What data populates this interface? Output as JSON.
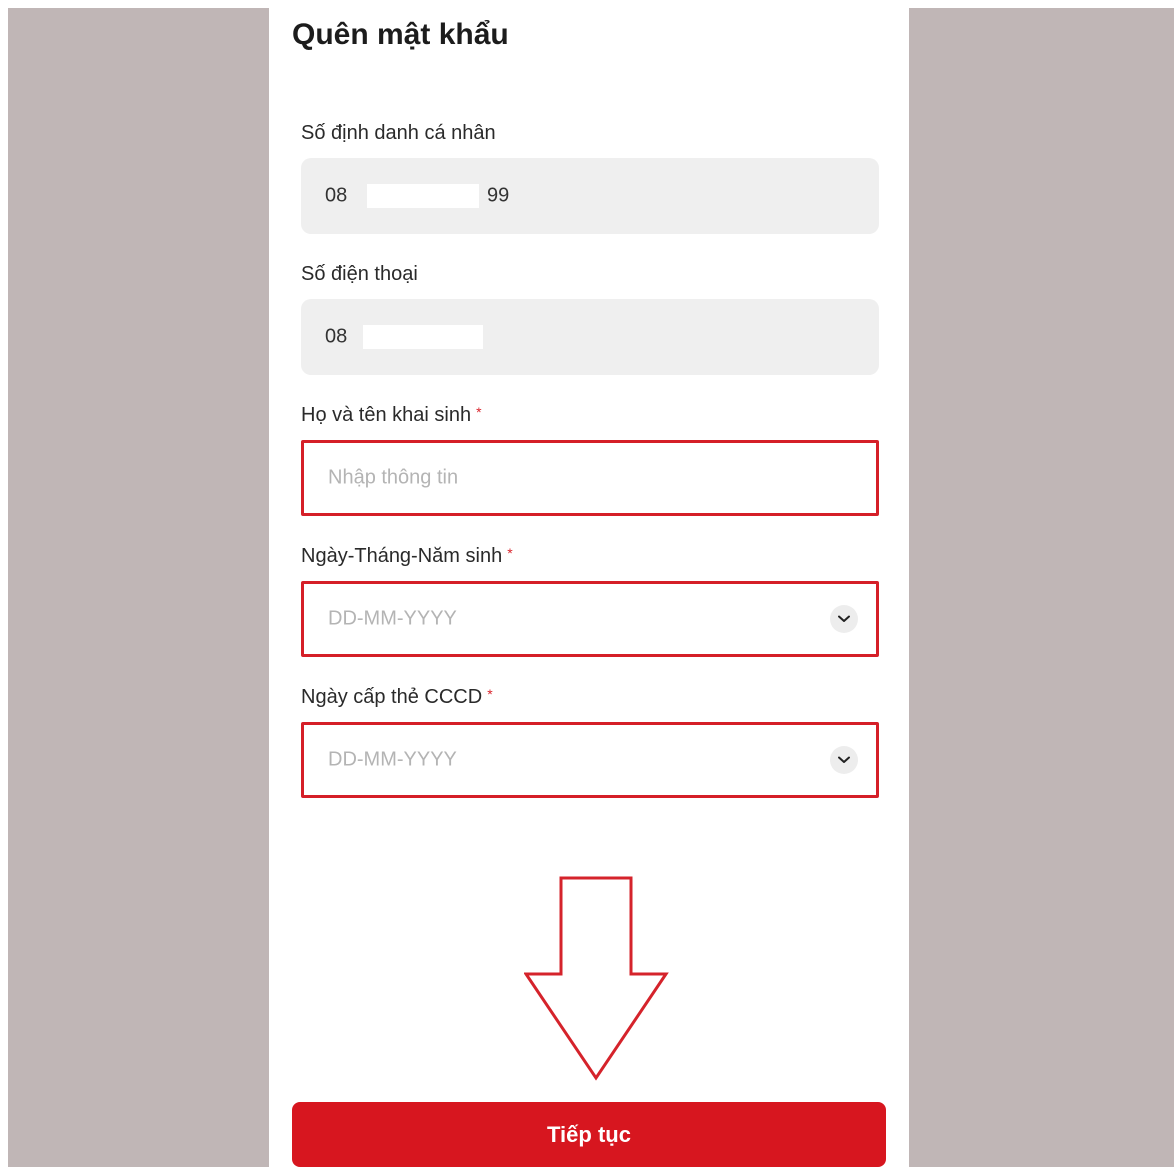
{
  "page": {
    "title": "Quên mật khẩu"
  },
  "form": {
    "id_number": {
      "label": "Số định danh cá nhân",
      "value_prefix": "08",
      "value_suffix": "99"
    },
    "phone": {
      "label": "Số điện thoại",
      "value_prefix": "08"
    },
    "full_name": {
      "label": "Họ và tên khai sinh",
      "required_mark": "*",
      "placeholder": "Nhập thông tin"
    },
    "birth_date": {
      "label": "Ngày-Tháng-Năm sinh",
      "required_mark": "*",
      "placeholder": "DD-MM-YYYY"
    },
    "issue_date": {
      "label": "Ngày cấp thẻ CCCD",
      "required_mark": "*",
      "placeholder": "DD-MM-YYYY"
    }
  },
  "submit": {
    "label": "Tiếp tục"
  },
  "colors": {
    "accent": "#d7161f",
    "error_border": "#d51f28",
    "backdrop": "#c0b6b6"
  }
}
